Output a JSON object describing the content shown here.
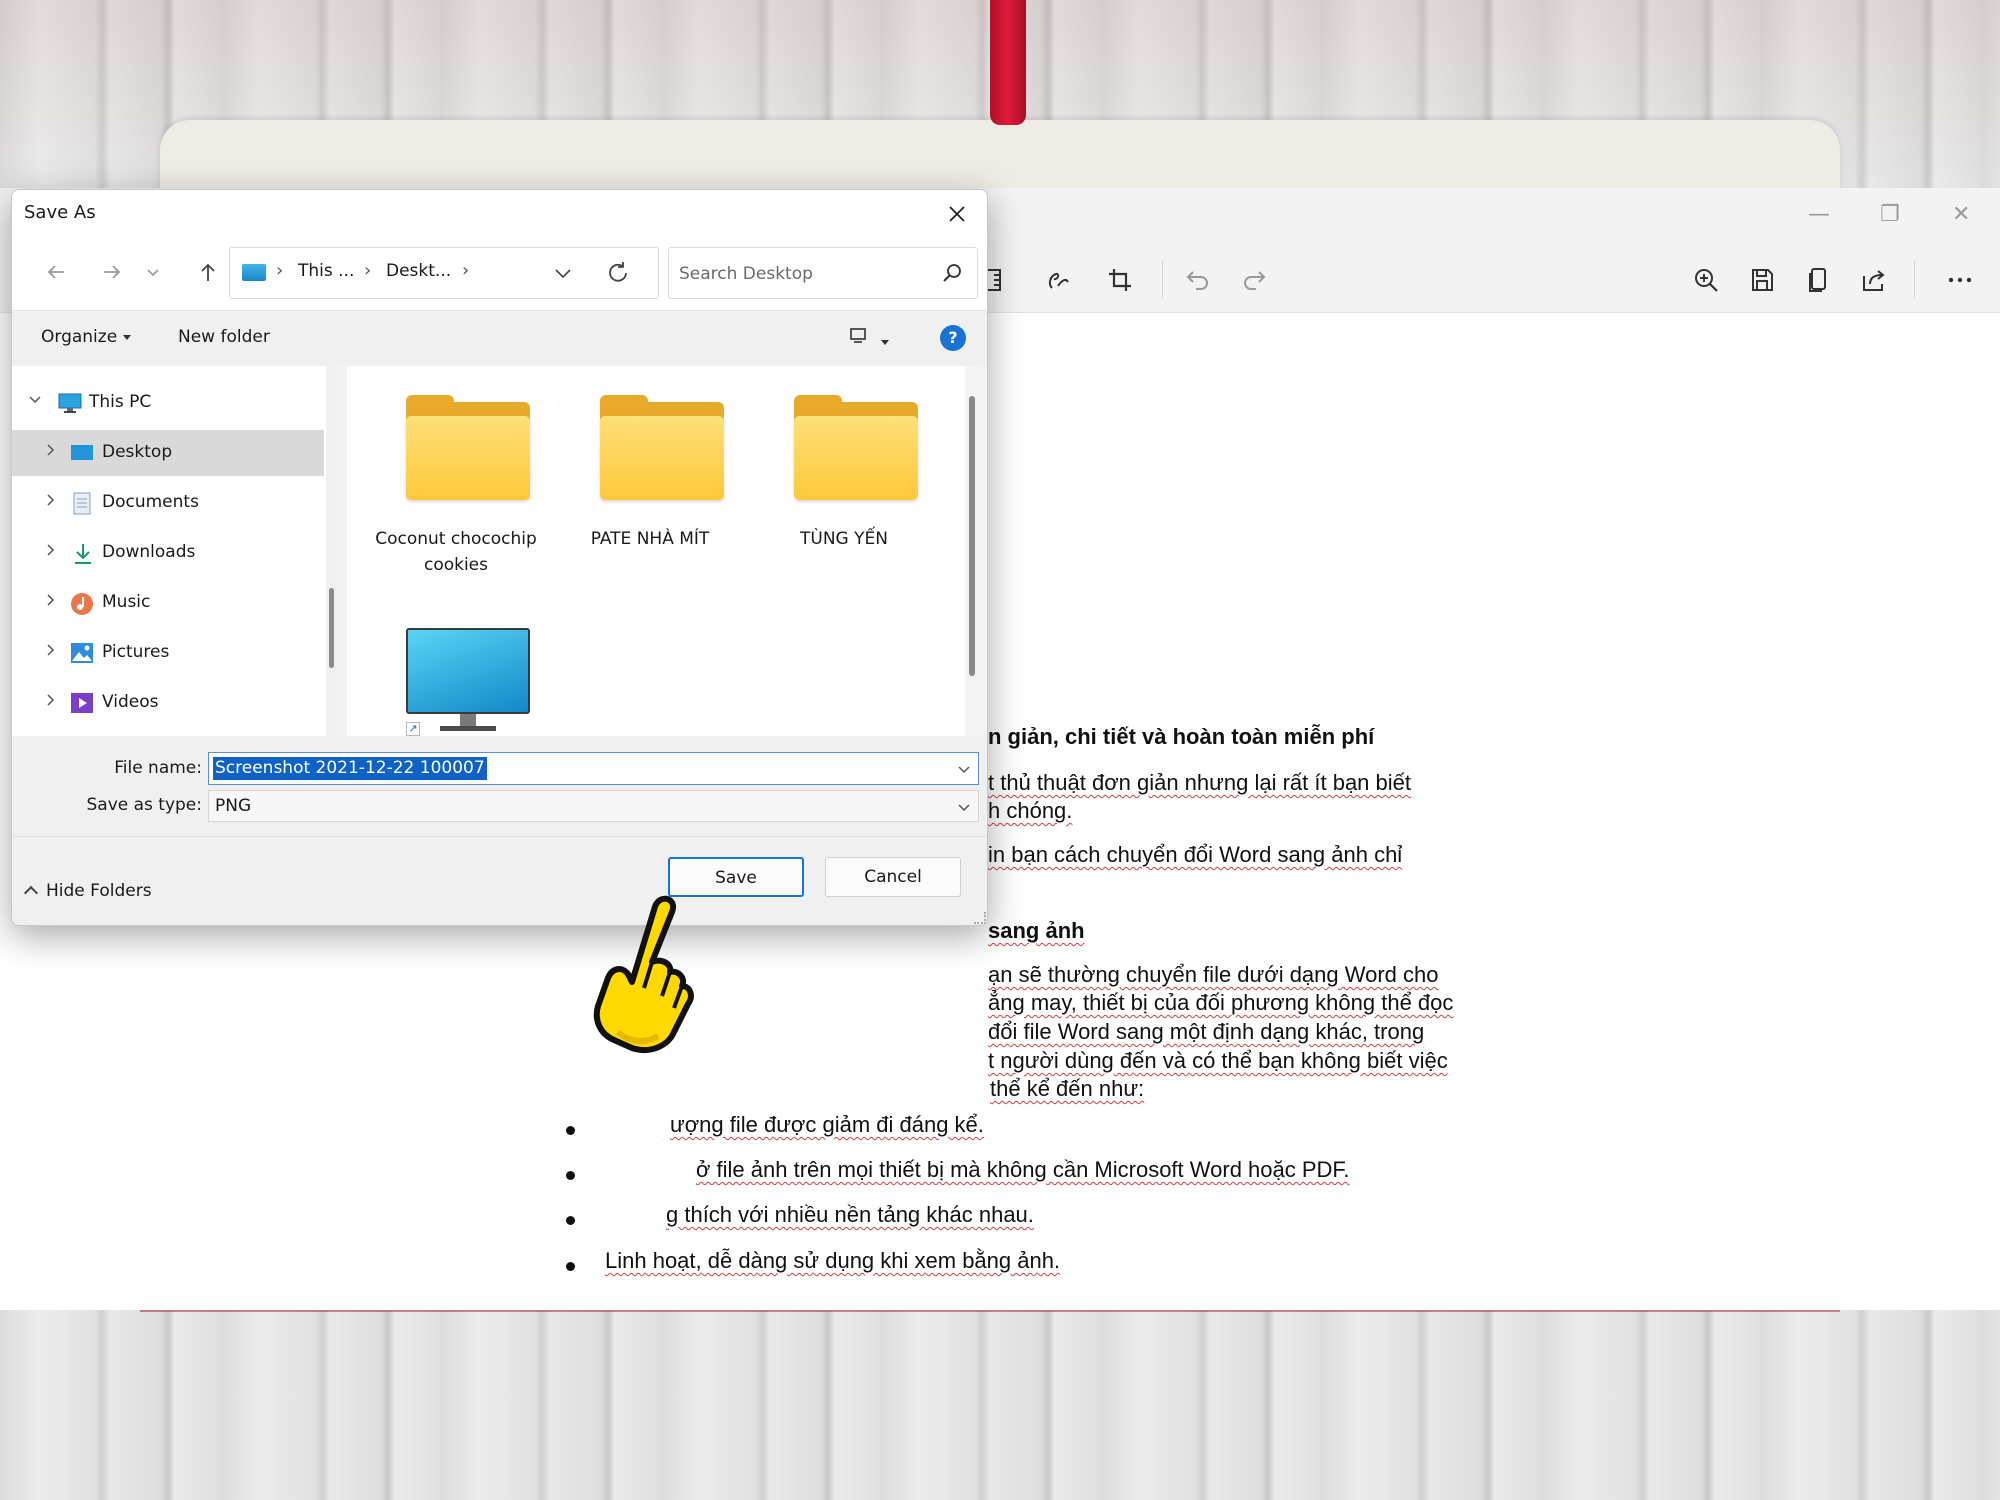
{
  "dialog": {
    "title": "Save As",
    "nav": {
      "breadcrumb": [
        "This ...",
        "Deskt..."
      ],
      "search_placeholder": "Search Desktop"
    },
    "toolbar": {
      "organize_label": "Organize",
      "new_folder_label": "New folder",
      "help_label": "?"
    },
    "tree": {
      "items": [
        {
          "label": "This PC",
          "icon": "computer-icon"
        },
        {
          "label": "Desktop",
          "icon": "desktop-icon",
          "selected": true
        },
        {
          "label": "Documents",
          "icon": "documents-icon"
        },
        {
          "label": "Downloads",
          "icon": "downloads-icon"
        },
        {
          "label": "Music",
          "icon": "music-icon"
        },
        {
          "label": "Pictures",
          "icon": "pictures-icon"
        },
        {
          "label": "Videos",
          "icon": "videos-icon"
        }
      ]
    },
    "files": [
      {
        "name": "Coconut chocochip cookies",
        "type": "folder"
      },
      {
        "name": "PATE NHÀ MÍT",
        "type": "folder"
      },
      {
        "name": "TÙNG YẾN",
        "type": "folder"
      },
      {
        "name": "",
        "type": "shortcut"
      }
    ],
    "form": {
      "file_name_label": "File name:",
      "file_name_value": "Screenshot 2021-12-22 100007",
      "save_type_label": "Save as type:",
      "save_type_value": "PNG"
    },
    "footer": {
      "hide_folders_label": "Hide Folders",
      "save_label": "Save",
      "cancel_label": "Cancel"
    }
  },
  "document": {
    "heading1": "n giản, chi tiết và hoàn toàn miễn phí",
    "para1_line1": "t thủ thuật đơn giản nhưng lại rất ít bạn biết",
    "para1_line2": "h chóng.",
    "para2_line1": "in bạn cách chuyển đổi Word sang ảnh chỉ",
    "heading2": "sang ảnh",
    "para3": [
      "ạn sẽ thường chuyển file dưới dạng Word cho",
      "ẳng may, thiết bị của đối phương không thể đọc",
      "đổi file Word sang một định dạng khác, trong",
      "t người dùng đến và có thể bạn không biết việc",
      "thể kể đến như:"
    ],
    "bullets": [
      "ượng file được giảm đi đáng kể.",
      "ở file ảnh trên mọi thiết bị mà không cần Microsoft Word hoặc PDF.",
      "g thích với nhiều nền tảng khác nhau.",
      "Linh hoạt, dễ dàng sử dụng khi xem bằng ảnh."
    ]
  },
  "colors": {
    "accent": "#1a73d4",
    "selection": "#0e62c6",
    "folder": "#ffc83a"
  }
}
